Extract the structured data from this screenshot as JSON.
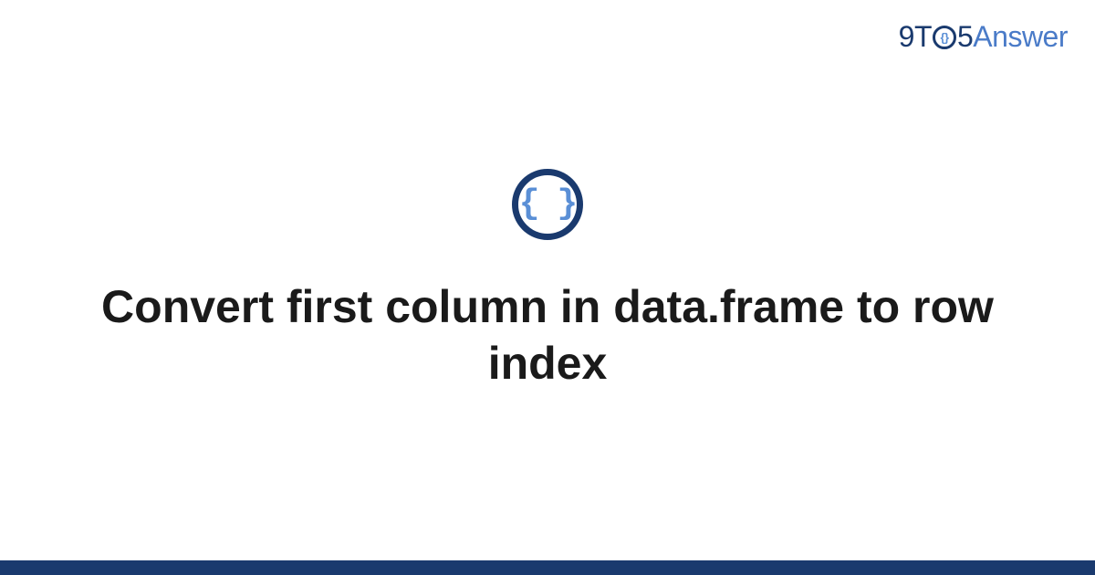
{
  "brand": {
    "part1": "9T",
    "o_inner": "{}",
    "part2": "5",
    "part3": "Answer"
  },
  "category_icon": {
    "symbol": "{ }",
    "name": "code-braces"
  },
  "title": "Convert first column in data.frame to row index",
  "colors": {
    "primary_dark": "#1a3a6e",
    "primary_light": "#4a7bc8",
    "accent": "#5a8fd6"
  }
}
